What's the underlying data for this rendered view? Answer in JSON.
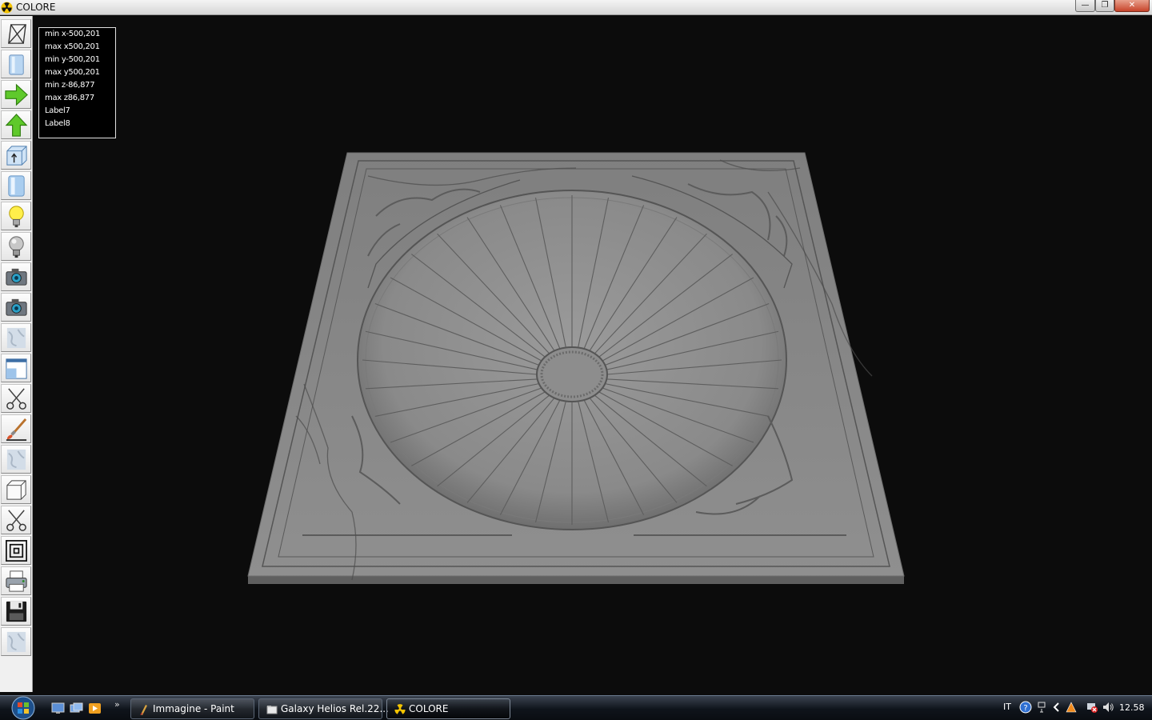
{
  "window": {
    "title": "COLORE",
    "minimize": "—",
    "maximize": "❐",
    "close": "✕"
  },
  "toolbar": {
    "tools": [
      {
        "name": "wireframe-view-button",
        "icon": "wireframe-box-icon"
      },
      {
        "name": "solid-view-button",
        "icon": "solid-panel-icon"
      },
      {
        "name": "rotate-right-button",
        "icon": "arrow-right-green-icon"
      },
      {
        "name": "rotate-up-button",
        "icon": "arrow-up-green-icon"
      },
      {
        "name": "depth-view-button",
        "icon": "box-arrow-icon"
      },
      {
        "name": "front-view-button",
        "icon": "glass-panel-icon"
      },
      {
        "name": "light-on-button",
        "icon": "lightbulb-on-icon"
      },
      {
        "name": "light-off-button",
        "icon": "lightbulb-off-icon"
      },
      {
        "name": "camera-button",
        "icon": "camera-icon"
      },
      {
        "name": "camera-2-button",
        "icon": "camera-icon"
      },
      {
        "name": "texture-button",
        "icon": "marble-texture-icon"
      },
      {
        "name": "window-view-button",
        "icon": "window-icon"
      },
      {
        "name": "cut-button",
        "icon": "scissors-icon"
      },
      {
        "name": "paint-button",
        "icon": "paintbrush-icon"
      },
      {
        "name": "texture-2-button",
        "icon": "marble-texture-icon"
      },
      {
        "name": "cube-button",
        "icon": "cube-icon"
      },
      {
        "name": "cut-2-button",
        "icon": "scissors-icon"
      },
      {
        "name": "frames-button",
        "icon": "concentric-squares-icon"
      },
      {
        "name": "print-button",
        "icon": "printer-icon"
      },
      {
        "name": "save-button",
        "icon": "floppy-disk-icon"
      },
      {
        "name": "texture-3-button",
        "icon": "marble-texture-icon"
      }
    ]
  },
  "info": {
    "lines": [
      "min x-500,201",
      "max x500,201",
      "min y-500,201",
      "max y500,201",
      "min z-86,877",
      "max z86,877",
      "Label7",
      "Label8"
    ]
  },
  "taskbar": {
    "more": "»",
    "tasks": [
      {
        "label": "Immagine - Paint",
        "icon": "paint-icon"
      },
      {
        "label": "Galaxy Helios  Rel.22...",
        "icon": "folder-icon"
      },
      {
        "label": "COLORE",
        "icon": "radiation-icon"
      }
    ],
    "language": "IT",
    "clock": "12.58"
  },
  "colors": {
    "marble": "#8c8c8c",
    "marble_edge": "#6e6e6e",
    "background": "#0c0c0c"
  }
}
